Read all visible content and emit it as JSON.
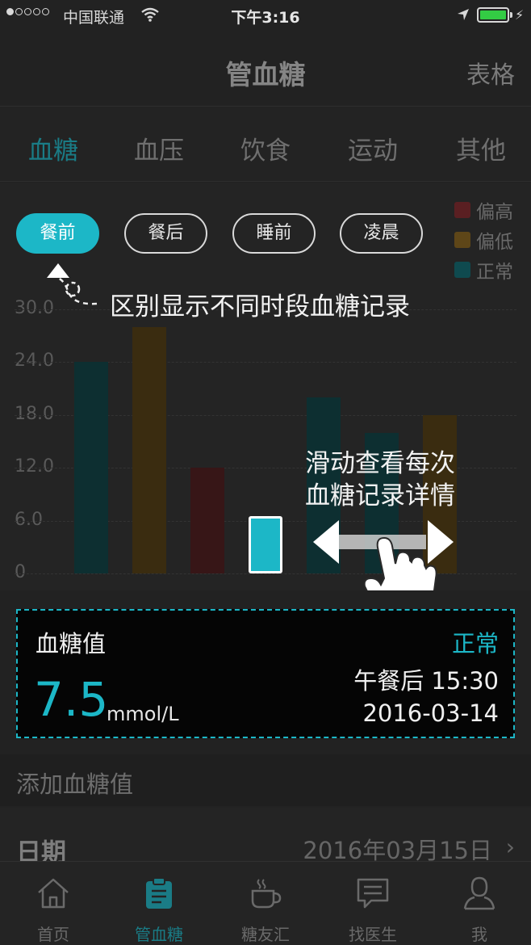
{
  "status_bar": {
    "carrier": "中国联通",
    "time": "下午3:16",
    "signal_dots": 5,
    "signal_filled": 1,
    "icons": [
      "wifi-icon",
      "location-arrow-icon",
      "battery-icon",
      "charging-bolt-icon"
    ]
  },
  "navbar": {
    "title": "管血糖",
    "right_button": "表格"
  },
  "tabs": [
    {
      "label": "血糖",
      "active": true
    },
    {
      "label": "血压",
      "active": false
    },
    {
      "label": "饮食",
      "active": false
    },
    {
      "label": "运动",
      "active": false
    },
    {
      "label": "其他",
      "active": false
    }
  ],
  "filters": [
    {
      "label": "餐前",
      "active": true
    },
    {
      "label": "餐后",
      "active": false
    },
    {
      "label": "睡前",
      "active": false
    },
    {
      "label": "凌晨",
      "active": false
    }
  ],
  "legend": [
    {
      "label": "偏高",
      "color": "#5a1f22"
    },
    {
      "label": "偏低",
      "color": "#5e4618"
    },
    {
      "label": "正常",
      "color": "#0f4a4f"
    }
  ],
  "hints": {
    "filter_hint": "区别显示不同时段血糖记录",
    "swipe_hint_line1": "滑动查看每次",
    "swipe_hint_line2": "血糖记录详情"
  },
  "chart_data": {
    "type": "bar",
    "ylim": [
      0,
      30
    ],
    "yticks": [
      "30.0",
      "24.0",
      "18.0",
      "12.0",
      "6.0",
      "0"
    ],
    "values": [
      24,
      28,
      12,
      6.5,
      20,
      16,
      18
    ],
    "status": [
      "正常",
      "偏低",
      "偏高",
      "正常",
      "正常",
      "正常",
      "偏低"
    ],
    "selected_index": 3,
    "colors": {
      "正常": "#0d2f31",
      "偏低": "#3a2c10",
      "偏高": "#371617",
      "selected": "#1cb7c7"
    }
  },
  "detail_card": {
    "label": "血糖值",
    "status": "正常",
    "value": "7.5",
    "unit": "mmol/L",
    "meal_time": "午餐后  15:30",
    "date": "2016-03-14"
  },
  "form": {
    "section_title": "添加血糖值",
    "date_label": "日期",
    "date_value": "2016年03月15日"
  },
  "tabbar": [
    {
      "label": "首页",
      "icon": "home-icon",
      "active": false
    },
    {
      "label": "管血糖",
      "icon": "clipboard-icon",
      "active": true
    },
    {
      "label": "糖友汇",
      "icon": "coffee-cup-icon",
      "active": false
    },
    {
      "label": "找医生",
      "icon": "chat-bubble-icon",
      "active": false
    },
    {
      "label": "我",
      "icon": "user-icon",
      "active": false
    }
  ]
}
